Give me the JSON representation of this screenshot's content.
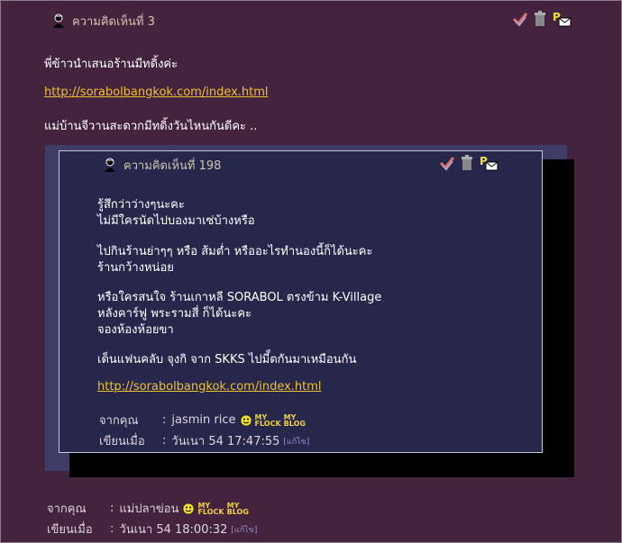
{
  "comment": {
    "title": "ความคิดเห็นที่ 3",
    "lines": [
      "พี่ข้าวนำเสนอร้านมีทดิ้งค่ะ",
      "แม่บ้านจีวานสะดวกมีทดิ้งวันไหนกันดีคะ .."
    ],
    "link": "http://sorabolbangkok.com/index.html",
    "author_label": "จากคุณ",
    "author": "แม่ปลาข่อน",
    "time_label": "เขียนเมื่อ",
    "time": "วันเนา 54 18:00:32",
    "edit": "[แก้ไข]"
  },
  "quoted": {
    "title": "ความคิดเห็นที่ 198",
    "lines": [
      "รู้สึกว่าว่างๆนะคะ",
      "ไม่มีใครนัดไปบองมาเซ่บ้างหรือ",
      "ไปกินร้านย่าๆๆ หรือ ส้มต่ำ หรืออะไรทำนองนี้ก็ได้นะคะ",
      "ร้านกว้างหน่อย",
      "หรือใครสนใจ ร้านเกาหลี SORABOL ตรงข้าม K-Village",
      "หลังคาร์ฟู พระรามสี่ ก็ได้นะคะ",
      "จองห้องห้อยขา",
      "เด็นแฟนคลับ จุงกิ จาก SKKS ไปมี็ตกันมาเหมือนกัน"
    ],
    "link": "http://sorabolbangkok.com/index.html",
    "author_label": "จากคุณ",
    "author": "jasmin rice",
    "time_label": "เขียนเมื่อ",
    "time": "วันเนา 54 17:47:55",
    "edit": "[แก้ไข]"
  },
  "badges": {
    "flock_top": "MY",
    "flock_bottom": "FLOCK",
    "blog_top": "MY",
    "blog_bottom": "BLOG"
  },
  "colors": {
    "background": "#44233f",
    "quote_outer": "#3f3d68",
    "quote_inner": "#26274a",
    "link": "#f0c030"
  },
  "icons": [
    "avatar-icon",
    "check-icon",
    "trash-icon",
    "message-icon",
    "smiley-icon"
  ]
}
